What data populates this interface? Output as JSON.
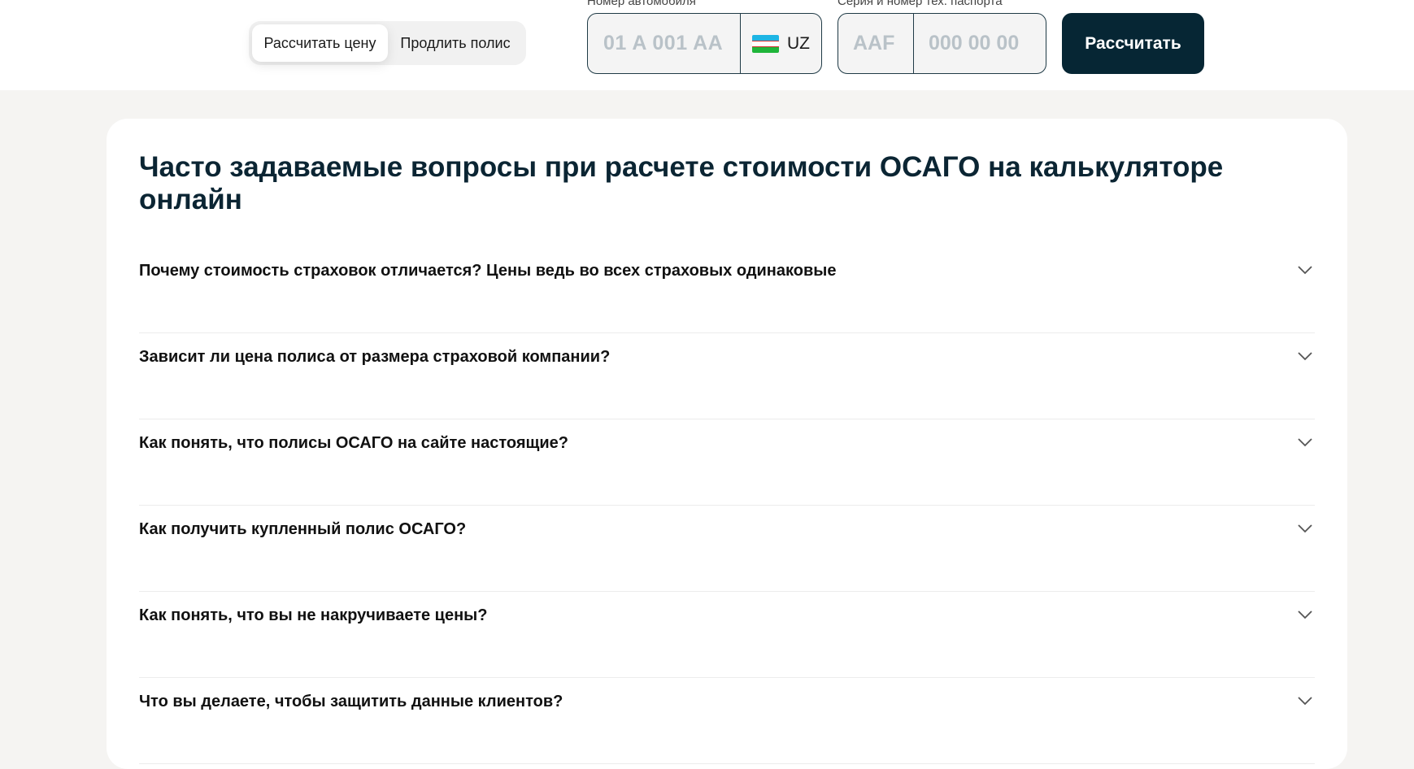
{
  "header": {
    "tabs": [
      {
        "label": "Рассчитать цену",
        "active": true
      },
      {
        "label": "Продлить полис",
        "active": false
      }
    ],
    "plate": {
      "label": "Номер автомобиля",
      "placeholder": "01 A 001 AA",
      "country": "UZ",
      "flag_colors": [
        "#1eb5e4",
        "#ffffff",
        "#1fb53a"
      ]
    },
    "passport": {
      "label": "Серия и номер тех. паспорта",
      "series_placeholder": "AAF",
      "number_placeholder": "000 00 00"
    },
    "submit_label": "Рассчитать"
  },
  "faq": {
    "title": "Часто задаваемые вопросы при расчете стоимости ОСАГО на калькуляторе онлайн",
    "items": [
      {
        "question": "Почему стоимость страховок отличается? Цены ведь во всех страховых одинаковые"
      },
      {
        "question": "Зависит ли цена полиса от размера страховой компании?"
      },
      {
        "question": "Как понять, что полисы ОСАГО на сайте настоящие?"
      },
      {
        "question": "Как получить купленный полис ОСАГО?"
      },
      {
        "question": "Как понять, что вы не накручиваете цены?"
      },
      {
        "question": "Что вы делаете, чтобы защитить данные клиентов?"
      }
    ]
  },
  "colors": {
    "accent": "#062634",
    "page_bg": "#f5f4f2",
    "card_bg": "#ffffff"
  }
}
